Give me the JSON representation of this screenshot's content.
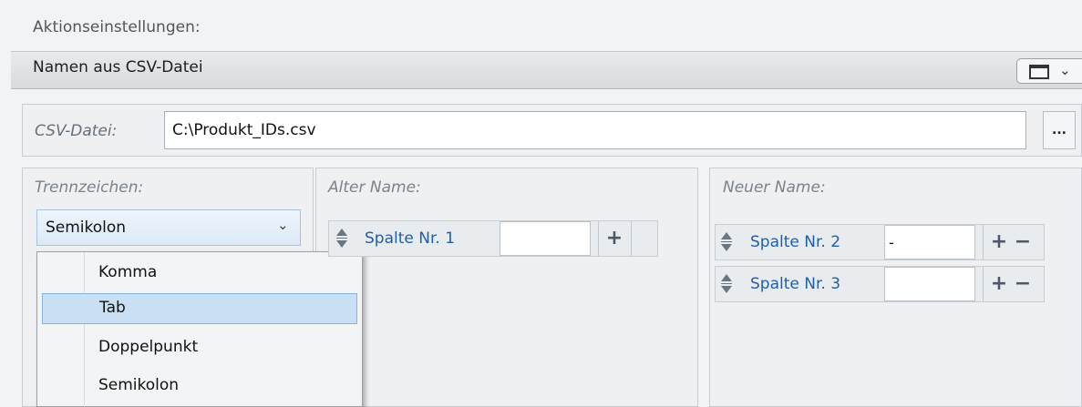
{
  "header": {
    "settings_label": "Aktionseinstellungen:",
    "section_title": "Namen aus CSV-Datei"
  },
  "csv": {
    "label": "CSV-Datei:",
    "value": "C:\\Produkt_IDs.csv",
    "browse_label": "..."
  },
  "separator": {
    "label": "Trennzeichen:",
    "selected": "Semikolon",
    "options": [
      "Komma",
      "Tab",
      "Doppelpunkt",
      "Semikolon"
    ],
    "highlighted": "Tab"
  },
  "old_name": {
    "label": "Alter Name:",
    "rows": [
      {
        "column": "Spalte Nr. 1",
        "value": ""
      }
    ]
  },
  "new_name": {
    "label": "Neuer Name:",
    "rows": [
      {
        "column": "Spalte Nr. 2",
        "value": "-"
      },
      {
        "column": "Spalte Nr. 3",
        "value": ""
      }
    ]
  },
  "icons": {
    "chevron": "⌄",
    "plus": "+",
    "minus": "−"
  }
}
